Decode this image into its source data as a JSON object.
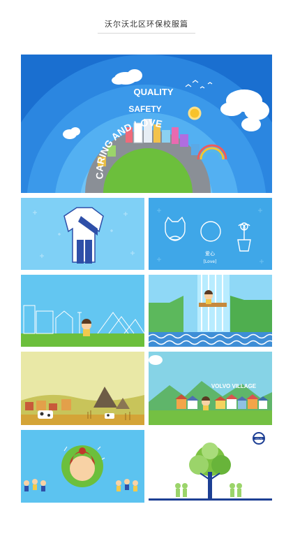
{
  "page": {
    "title": "沃尔沃北区环保校服篇"
  },
  "hero": {
    "words": [
      "QUALITY",
      "SAFETY",
      "CARING AND LOVE"
    ]
  },
  "panel_love": {
    "label_cn": "爱心",
    "label_en": "[Love]"
  },
  "panel_village": {
    "sign": "VOLVO VILLAGE"
  },
  "panel_tree": {
    "logo_text": "VOLVO"
  },
  "colors": {
    "sky_blue": "#5bc0ee",
    "grass": "#7cc242",
    "navy": "#1d3f94"
  }
}
